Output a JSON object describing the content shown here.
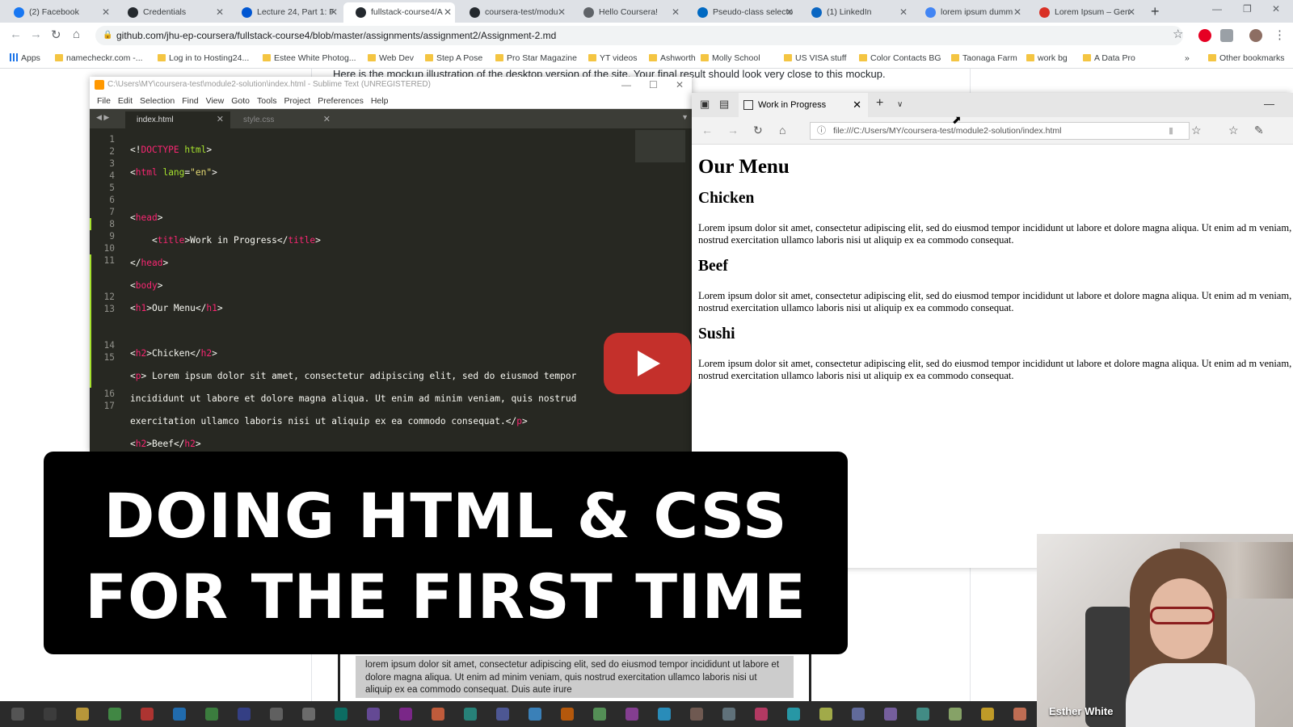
{
  "chrome": {
    "tabs": [
      {
        "label": "(2) Facebook",
        "icon": "facebook-icon",
        "color": "#1877f2"
      },
      {
        "label": "Credentials",
        "icon": "github-icon",
        "color": "#24292e"
      },
      {
        "label": "Lecture 24, Part 1: F",
        "icon": "coursera-icon",
        "color": "#0056d2"
      },
      {
        "label": "fullstack-course4/A",
        "icon": "github-icon",
        "color": "#24292e"
      },
      {
        "label": "coursera-test/modu",
        "icon": "github-icon",
        "color": "#24292e"
      },
      {
        "label": "Hello Coursera!",
        "icon": "globe-icon",
        "color": "#5f6368"
      },
      {
        "label": "Pseudo-class selecto",
        "icon": "mdn-icon",
        "color": "#0069c2"
      },
      {
        "label": "(1) LinkedIn",
        "icon": "linkedin-icon",
        "color": "#0a66c2"
      },
      {
        "label": "lorem ipsum dumm",
        "icon": "google-icon",
        "color": "#4285f4"
      },
      {
        "label": "Lorem Ipsum – Gen",
        "icon": "lipsum-icon",
        "color": "#d93025"
      }
    ],
    "url": "github.com/jhu-ep-coursera/fullstack-course4/blob/master/assignments/assignment2/Assignment-2.md",
    "bookmarks": [
      "Apps",
      "namecheckr.com -...",
      "Log in to Hosting24...",
      "Estee White Photog...",
      "Web Dev",
      "Step A Pose",
      "Pro Star Magazine",
      "YT videos",
      "Ashworth",
      "Molly School",
      "US VISA stuff",
      "Color Contacts BG",
      "Taonaga Farm",
      "work bg",
      "A Data Pro"
    ],
    "other_bookmarks": "Other bookmarks",
    "page_text": "Here is the mockup illustration of the desktop version of the site. Your final result should look very close to this mockup."
  },
  "sublime": {
    "title": "C:\\Users\\MY\\coursera-test\\module2-solution\\index.html - Sublime Text (UNREGISTERED)",
    "menu": [
      "File",
      "Edit",
      "Selection",
      "Find",
      "View",
      "Goto",
      "Tools",
      "Project",
      "Preferences",
      "Help"
    ],
    "tabs": [
      "index.html",
      "style.css"
    ],
    "gutter": [
      "1",
      "2",
      "3",
      "4",
      "5",
      "6",
      "7",
      "8",
      "9",
      "10",
      "11",
      "",
      "",
      "12",
      "13",
      "",
      "",
      "14",
      "15",
      "",
      "",
      "16",
      "17"
    ]
  },
  "edge": {
    "tab_title": "Work in Progress",
    "url": "file:///C:/Users/MY/coursera-test/module2-solution/index.html",
    "h1": "Our Menu",
    "sections": [
      {
        "heading": "Chicken",
        "text": "Lorem ipsum dolor sit amet, consectetur adipiscing elit, sed do eiusmod tempor incididunt ut labore et dolore magna aliqua. Ut enim ad m veniam, quis nostrud exercitation ullamco laboris nisi ut aliquip ex ea commodo consequat."
      },
      {
        "heading": "Beef",
        "text": "Lorem ipsum dolor sit amet, consectetur adipiscing elit, sed do eiusmod tempor incididunt ut labore et dolore magna aliqua. Ut enim ad m veniam, quis nostrud exercitation ullamco laboris nisi ut aliquip ex ea commodo consequat."
      },
      {
        "heading": "Sushi",
        "text": "Lorem ipsum dolor sit amet, consectetur adipiscing elit, sed do eiusmod tempor incididunt ut labore et dolore magna aliqua. Ut enim ad m veniam, quis nostrud exercitation ullamco laboris nisi ut aliquip ex ea commodo consequat."
      }
    ]
  },
  "overlay": {
    "line1": "DOING HTML & CSS",
    "line2": "FOR THE FIRST TIME"
  },
  "snippet_text": "lorem ipsum dolor sit amet, consectetur adipiscing elit, sed do eiusmod tempor incididunt ut labore et dolore magna aliqua. Ut enim ad minim veniam, quis nostrud exercitation ullamco laboris nisi ut aliquip ex ea commodo consequat. Duis aute irure",
  "webcam": {
    "name": "Esther White"
  }
}
